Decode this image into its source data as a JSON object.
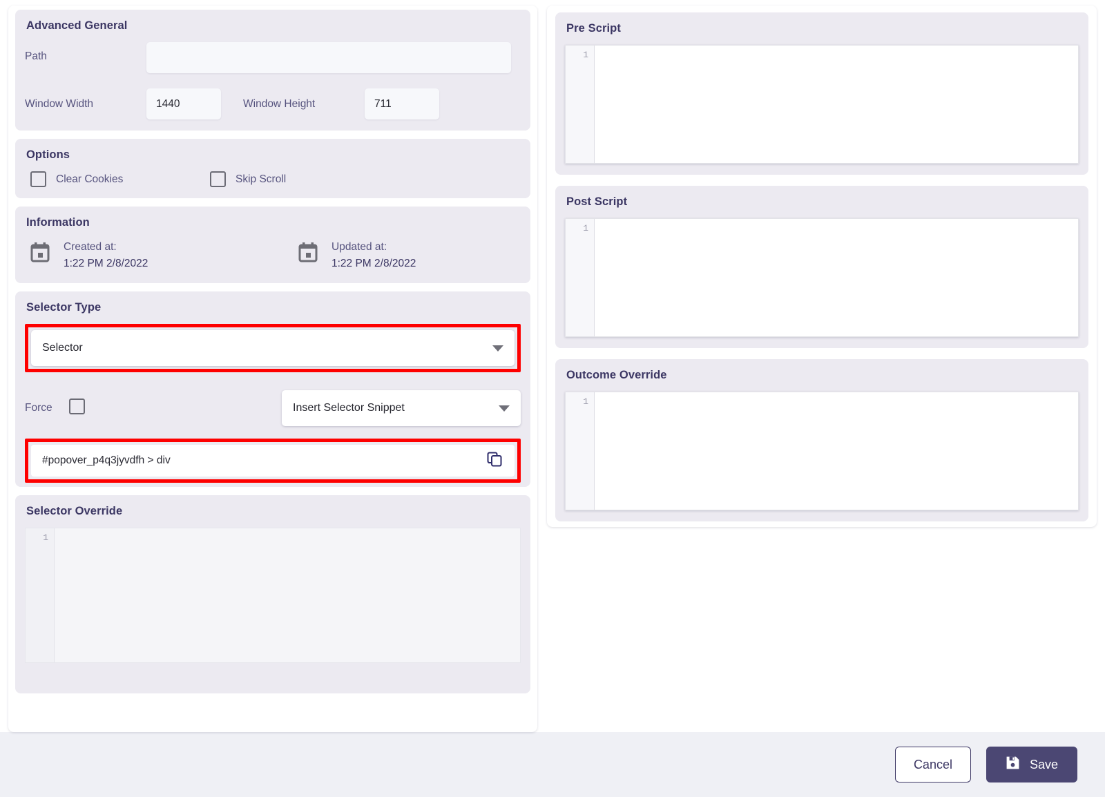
{
  "left": {
    "advanced_general": {
      "title": "Advanced General",
      "path_label": "Path",
      "path_value": "",
      "path_placeholder": "",
      "window_width_label": "Window Width",
      "window_width_value": "1440",
      "window_height_label": "Window Height",
      "window_height_value": "711"
    },
    "options": {
      "title": "Options",
      "clear_cookies_label": "Clear Cookies",
      "clear_cookies_checked": false,
      "skip_scroll_label": "Skip Scroll",
      "skip_scroll_checked": false
    },
    "information": {
      "title": "Information",
      "created_label": "Created at:",
      "created_value": "1:22 PM 2/8/2022",
      "updated_label": "Updated at:",
      "updated_value": "1:22 PM 2/8/2022",
      "calendar_icon": "calendar-icon"
    },
    "selector_type": {
      "title": "Selector Type",
      "selected": "Selector",
      "dropdown_icon": "chevron-down-icon",
      "force_label": "Force",
      "force_checked": false,
      "snippet_selected": "Insert Selector Snippet",
      "selector_value": "#popover_p4q3jyvdfh > div",
      "copy_icon": "copy-icon",
      "highlighted": true
    },
    "selector_override": {
      "title": "Selector Override",
      "line_number": "1",
      "code": ""
    }
  },
  "right": {
    "pre_script": {
      "title": "Pre Script",
      "line_number": "1",
      "code": ""
    },
    "post_script": {
      "title": "Post Script",
      "line_number": "1",
      "code": ""
    },
    "outcome_override": {
      "title": "Outcome Override",
      "line_number": "1",
      "code": ""
    }
  },
  "footer": {
    "cancel_label": "Cancel",
    "save_label": "Save",
    "save_icon": "save-disk-icon"
  },
  "colors": {
    "highlight": "#fe0000",
    "accent": "#4b4773",
    "card_bg": "#eceaf1",
    "footer_bg": "#eff0f5",
    "heading": "#3b3663",
    "label": "#56537e"
  }
}
